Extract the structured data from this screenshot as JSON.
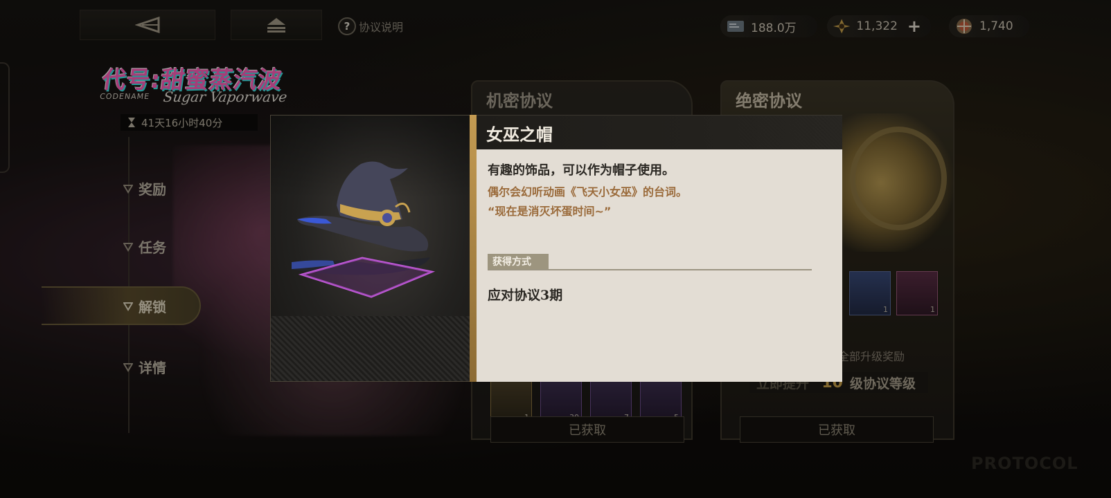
{
  "topbar": {
    "back_icon": "back-arrow-icon",
    "home_icon": "home-icon",
    "help_label": "协议说明",
    "resources": [
      {
        "icon": "credits-icon",
        "value": "188.0万"
      },
      {
        "icon": "energy-icon",
        "value": "11,322"
      },
      {
        "icon": "token-icon",
        "value": "1,740"
      }
    ]
  },
  "event": {
    "title_cn": "代号:甜蜜蒸汽波",
    "codename_label": "CODENAME",
    "title_en": "Sugar Vaporwave",
    "timer": "41天16小时40分"
  },
  "nav": {
    "items": [
      {
        "label": "奖励",
        "active": false
      },
      {
        "label": "任务",
        "active": false
      },
      {
        "label": "解锁",
        "active": true
      },
      {
        "label": "详情",
        "active": false
      }
    ]
  },
  "panels": {
    "confidential": {
      "title": "机密协议",
      "thumb_counts": [
        "1",
        "30",
        "7",
        "5"
      ],
      "button": "已获取"
    },
    "top_secret": {
      "title": "绝密协议",
      "thumb_counts": [
        "1",
        "1"
      ],
      "reward_text": "的全部升级奖励",
      "level_faint": "立即提升",
      "level_number": "10",
      "level_text": "级协议等级",
      "button": "已获取"
    }
  },
  "watermark": "PROTOCOL",
  "item_modal": {
    "name": "女巫之帽",
    "desc": "有趣的饰品，可以作为帽子使用。",
    "flavor_line1": "偶尔会幻听动画《飞天小女巫》的台词。",
    "flavor_line2": "“现在是消灭坏蛋时间~”",
    "obtain_label": "获得方式",
    "obtain_source": "应对协议3期",
    "accent_color": "#c49b52"
  }
}
